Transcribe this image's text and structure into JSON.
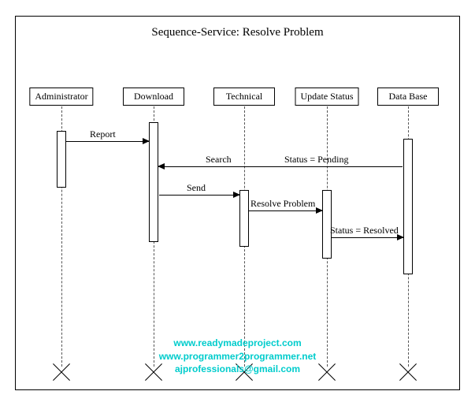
{
  "title": "Sequence-Service: Resolve Problem",
  "participants": {
    "p1": "Administrator",
    "p2": "Download",
    "p3": "Technical",
    "p4": "Update Status",
    "p5": "Data Base"
  },
  "messages": {
    "m1": "Report",
    "m2_left": "Search",
    "m2_right": "Status = Pending",
    "m3": "Send",
    "m4": "Resolve Problem",
    "m5": "Status = Resolved"
  },
  "watermark": {
    "line1": "www.readymadeproject.com",
    "line2": "www.programmer2programmer.net",
    "line3": "ajprofessionals@gmail.com"
  },
  "chart_data": {
    "type": "sequence-diagram",
    "title": "Sequence-Service: Resolve Problem",
    "participants": [
      "Administrator",
      "Download",
      "Technical",
      "Update Status",
      "Data Base"
    ],
    "messages": [
      {
        "from": "Administrator",
        "to": "Download",
        "label": "Report"
      },
      {
        "from": "Data Base",
        "to": "Download",
        "label": "Search / Status = Pending"
      },
      {
        "from": "Download",
        "to": "Technical",
        "label": "Send"
      },
      {
        "from": "Technical",
        "to": "Update Status",
        "label": "Resolve Problem"
      },
      {
        "from": "Update Status",
        "to": "Data Base",
        "label": "Status = Resolved"
      }
    ],
    "destroyed": [
      "Administrator",
      "Download",
      "Technical",
      "Update Status",
      "Data Base"
    ]
  }
}
